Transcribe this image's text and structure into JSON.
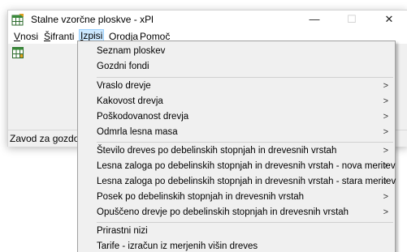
{
  "window": {
    "title": "Stalne vzorčne ploskve - xPl",
    "minimize_glyph": "—",
    "maximize_glyph": "☐",
    "close_glyph": "✕",
    "app_icon": "app-grid-icon"
  },
  "menubar": {
    "items": [
      {
        "mnemonic": "V",
        "rest": "nosi"
      },
      {
        "mnemonic": "Š",
        "rest": "ifranti"
      },
      {
        "mnemonic": "I",
        "rest": "zpisi"
      },
      {
        "mnemonic": "O",
        "rest": "rodja"
      },
      {
        "mnemonic": "P",
        "rest": "omoč"
      }
    ]
  },
  "toolbar": {
    "icon": "table-grid-icon"
  },
  "statusbar": {
    "text": "Zavod za gozdove"
  },
  "dropdown": {
    "items": [
      {
        "label": "Seznam ploskev"
      },
      {
        "label": "Gozdni fondi"
      },
      {
        "label": "Vraslo drevje",
        "arrow": ">"
      },
      {
        "label": "Kakovost drevja",
        "arrow": ">"
      },
      {
        "label": "Poškodovanost drevja",
        "arrow": ">"
      },
      {
        "label": "Odmrla lesna masa",
        "arrow": ">"
      },
      {
        "label": "Število dreves po debelinskih stopnjah in drevesnih vrstah",
        "arrow": ">"
      },
      {
        "label": "Lesna zaloga po debelinskih stopnjah in drevesnih vrstah - nova meritev",
        "arrow": ">"
      },
      {
        "label": "Lesna zaloga po debelinskih stopnjah in drevesnih vrstah - stara meritev",
        "arrow": ">"
      },
      {
        "label": "Posek po debelinskih stopnjah in drevesnih vrstah",
        "arrow": ">"
      },
      {
        "label": "Opuščeno drevje po debelinskih stopnjah in drevesnih vrstah",
        "arrow": ">"
      },
      {
        "label": "Prirastni nizi"
      },
      {
        "label": "Tarife - izračun iz merjenih višin dreves"
      }
    ]
  }
}
